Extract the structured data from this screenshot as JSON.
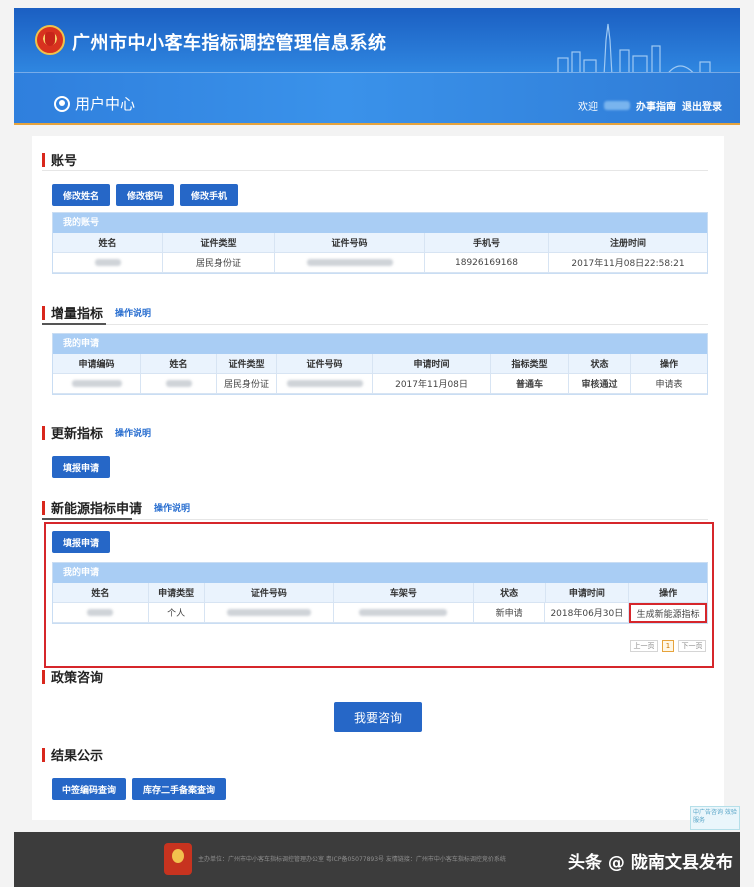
{
  "header": {
    "system_title": "广州市中小客车指标调控管理信息系统",
    "user_center": "用户中心",
    "welcome": "欢迎",
    "guide": "办事指南",
    "logout": "退出登录"
  },
  "account": {
    "title": "账号",
    "buttons": [
      "修改姓名",
      "修改密码",
      "修改手机"
    ],
    "table_caption": "我的账号",
    "columns": [
      "姓名",
      "证件类型",
      "证件号码",
      "手机号",
      "注册时间"
    ],
    "row": {
      "id_type": "居民身份证",
      "phone": "18926169168",
      "registered": "2017年11月08日22:58:21"
    }
  },
  "increment": {
    "title": "增量指标",
    "help": "操作说明",
    "table_caption": "我的申请",
    "columns": [
      "申请编码",
      "姓名",
      "证件类型",
      "证件号码",
      "申请时间",
      "指标类型",
      "状态",
      "操作"
    ],
    "row": {
      "id_type": "居民身份证",
      "apply_time": "2017年11月08日",
      "quota_type": "普通车",
      "status": "审核通过",
      "action": "申请表"
    }
  },
  "renewal": {
    "title": "更新指标",
    "help": "操作说明",
    "button": "填报申请"
  },
  "new_energy": {
    "title": "新能源指标申请",
    "help": "操作说明",
    "button": "填报申请",
    "table_caption": "我的申请",
    "columns": [
      "姓名",
      "申请类型",
      "证件号码",
      "车架号",
      "状态",
      "申请时间",
      "操作"
    ],
    "row": {
      "apply_type": "个人",
      "status": "新申请",
      "apply_time": "2018年06月30日",
      "action": "生成新能源指标"
    },
    "pager": {
      "prev": "上一页",
      "current": "1",
      "next": "下一页"
    }
  },
  "policy": {
    "title": "政策咨询",
    "button": "我要咨询"
  },
  "results": {
    "title": "结果公示",
    "buttons": [
      "中签编码查询",
      "库存二手备案查询"
    ]
  },
  "float_badge": "中广告咨询 效验服务",
  "footer": {
    "text": "主办单位：广州市中小客车指标调控管理办公室  粤ICP备05077893号  友情链接：广州市中小客车指标调控竞价系统",
    "watermark": "头条 @ 陇南文县发布"
  },
  "colors": {
    "primary": "#2667c7",
    "accent_red": "#d6262b",
    "header_blue": "#2f86e0",
    "status_green": "#1a9a3b"
  }
}
